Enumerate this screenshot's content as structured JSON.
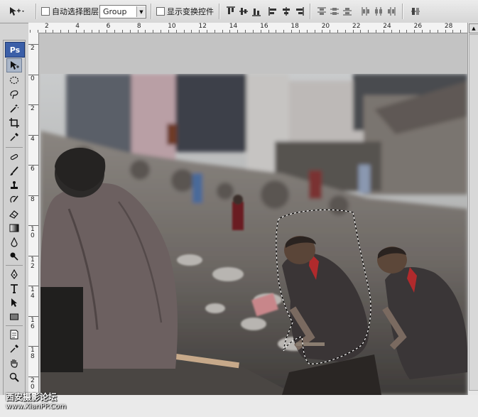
{
  "options_bar": {
    "auto_select_label": "自动选择图层",
    "auto_select_value": "Group",
    "show_transform_label": "显示变换控件"
  },
  "rulers": {
    "horizontal_labels": [
      "2",
      "2",
      "4",
      "6",
      "8",
      "10",
      "12",
      "14",
      "16",
      "18",
      "20",
      "22",
      "24",
      "26",
      "28"
    ],
    "vertical_labels": [
      "2",
      "0",
      "2",
      "4",
      "6",
      "8",
      "1\n0",
      "1\n2",
      "1\n4",
      "1\n6",
      "1\n8",
      "2\n0",
      "2\n2"
    ]
  },
  "toolbox": {
    "logo": "Ps",
    "tools": [
      "move-tool",
      "marquee-tool",
      "lasso-tool",
      "magic-wand-tool",
      "crop-tool",
      "eyedropper-tool",
      "healing-brush-tool",
      "brush-tool",
      "clone-stamp-tool",
      "history-brush-tool",
      "eraser-tool",
      "gradient-tool",
      "blur-tool",
      "dodge-tool",
      "pen-tool",
      "type-tool",
      "path-selection-tool",
      "shape-tool",
      "notes-tool",
      "eyedropper-tool-2",
      "hand-tool",
      "zoom-tool"
    ]
  },
  "watermark": {
    "line1": "西安摄影论坛",
    "line2": "www.XianPP.Com"
  }
}
